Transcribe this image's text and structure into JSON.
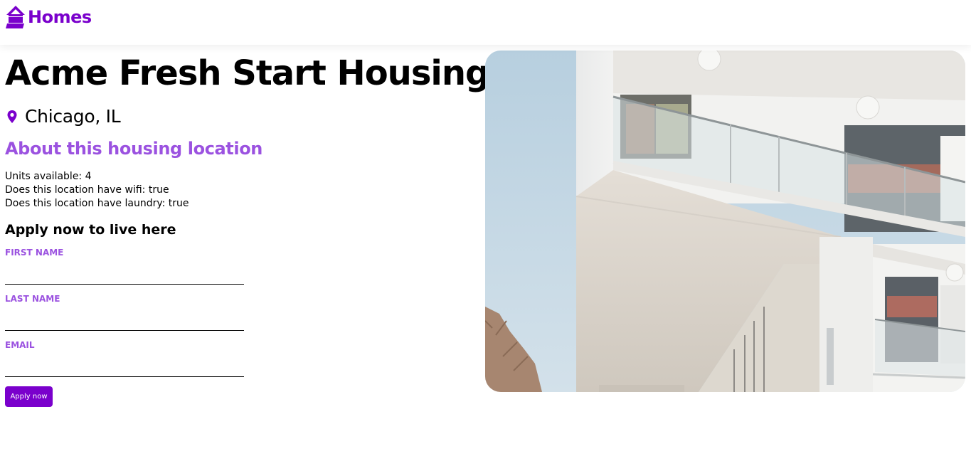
{
  "header": {
    "brand_text": "Homes",
    "brand_icon": "house-icon",
    "brand_color": "#7a00cc"
  },
  "listing": {
    "name": "Acme Fresh Start Housing",
    "location": "Chicago, IL",
    "location_icon": "map-pin-icon"
  },
  "about": {
    "heading": "About this housing location",
    "features": [
      "Units available: 4",
      "Does this location have wifi: true",
      "Does this location have laundry: true"
    ]
  },
  "application": {
    "heading": "Apply now to live here",
    "first_name_label": "First Name",
    "first_name_value": "",
    "last_name_label": "Last Name",
    "last_name_value": "",
    "email_label": "Email",
    "email_value": "",
    "submit_label": "Apply now"
  },
  "photo": {
    "subject": "white-modern-apartment-building-photo"
  },
  "colors": {
    "accent": "#7a00cc",
    "accent_light": "#9b52e0"
  }
}
